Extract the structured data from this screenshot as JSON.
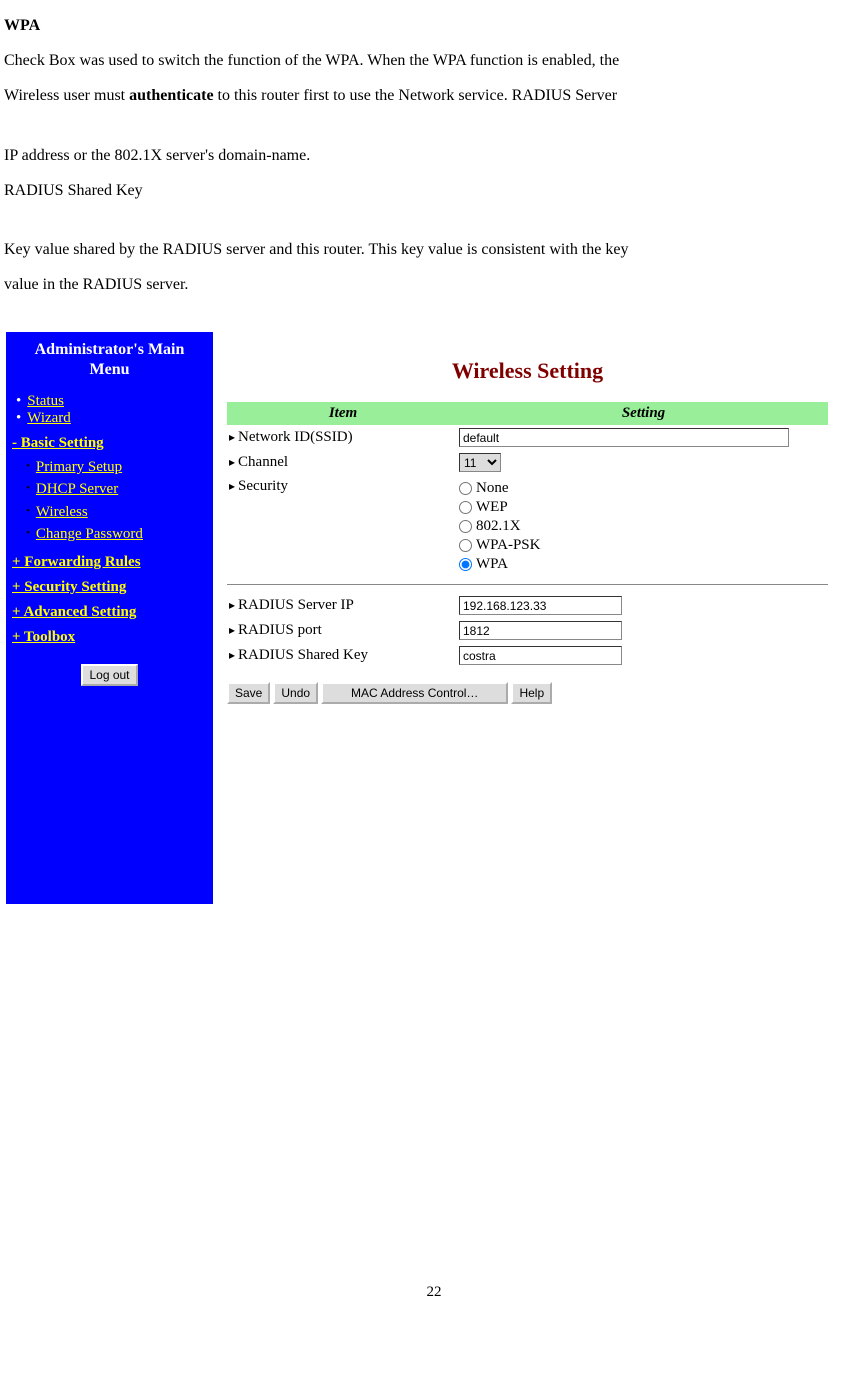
{
  "doc": {
    "heading": "WPA",
    "para1a": "Check Box was used to switch the function of the WPA. When the WPA function is enabled, the",
    "para1b_before": "Wireless user must ",
    "para1b_bold": "authenticate",
    "para1b_after": " to this router first to use the Network service. RADIUS Server",
    "para2": "IP address or the 802.1X server's domain-name.",
    "para3": "RADIUS Shared Key",
    "para4a": "Key value shared by the RADIUS server and this router. This key value is consistent with the key",
    "para4b": "value in the RADIUS server."
  },
  "sidebar": {
    "title1": "Administrator's Main",
    "title2": "Menu",
    "top": [
      {
        "label": "Status"
      },
      {
        "label": "Wizard"
      }
    ],
    "basic": {
      "label": "- Basic Setting",
      "items": [
        {
          "label": "Primary Setup"
        },
        {
          "label": "DHCP Server"
        },
        {
          "label": "Wireless"
        },
        {
          "label": "Change Password"
        }
      ]
    },
    "sections": [
      {
        "label": "+ Forwarding Rules"
      },
      {
        "label": "+ Security Setting"
      },
      {
        "label": "+ Advanced Setting"
      },
      {
        "label": "+ Toolbox"
      }
    ],
    "logout": "Log out"
  },
  "main": {
    "title": "Wireless Setting",
    "header_item": "Item",
    "header_setting": "Setting",
    "ssid_label": "Network ID(SSID)",
    "ssid_value": "default",
    "channel_label": "Channel",
    "channel_value": "11",
    "security_label": "Security",
    "security_options": [
      {
        "label": "None",
        "checked": false
      },
      {
        "label": "WEP",
        "checked": false
      },
      {
        "label": "802.1X",
        "checked": false
      },
      {
        "label": "WPA-PSK",
        "checked": false
      },
      {
        "label": "WPA",
        "checked": true
      }
    ],
    "radius_ip_label": "RADIUS Server IP",
    "radius_ip_value": "192.168.123.33",
    "radius_port_label": "RADIUS port",
    "radius_port_value": "1812",
    "radius_key_label": "RADIUS Shared Key",
    "radius_key_value": "costra",
    "buttons": {
      "save": "Save",
      "undo": "Undo",
      "mac": "MAC Address Control…",
      "help": "Help"
    }
  },
  "page_number": "22"
}
